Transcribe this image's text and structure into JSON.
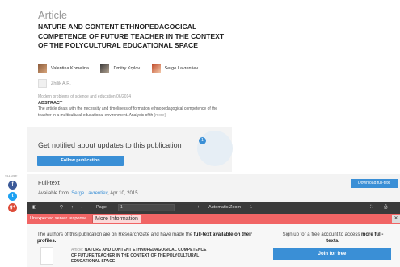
{
  "article": {
    "label": "Article",
    "title": "NATURE AND CONTENT ETHNOPEDAGOGICAL COMPETENCE OF FUTURE TEACHER IN THE CONTEXT OF THE POLYCULTURAL EDUCATIONAL SPACE",
    "authors": [
      "Valentina Komelina",
      "Dmitry Krylov",
      "Serge Lavrentiev",
      "Zhilik A.R."
    ],
    "journal": "Modern problems of science and education 06/2014",
    "abstract_heading": "ABSTRACT",
    "abstract_text": "The article deals with the necessity and timeliness of formation ethnopedagogical competence of the teacher in a multicultural educational environment. Analysis of th",
    "more_label": "[more]"
  },
  "notify": {
    "text": "Get notified about updates to this publication",
    "follow_label": "Follow publication",
    "badge": "1"
  },
  "share": {
    "label": "SHARE",
    "icons": [
      "facebook-icon",
      "twitter-icon",
      "google-plus-icon"
    ]
  },
  "fulltext": {
    "title": "Full-text",
    "available_prefix": "Available from: ",
    "author_link": "Serge Lavrentiev",
    "date": ", Apr 10, 2015",
    "download_label": "Download full-text"
  },
  "viewer": {
    "page_label": "Page:",
    "page_value": "1",
    "zoom_label": "Automatic Zoom",
    "total": "1"
  },
  "error": {
    "text": "Unexpected server response",
    "more_info": "More Information"
  },
  "bottom": {
    "note_prefix": "The authors of this publication are on ResearchGate and have made the ",
    "note_bold": "full-text available on their profiles.",
    "ref_label": "Article: ",
    "ref_title": "NATURE AND CONTENT ETHNOPEDAGOGICAL COMPETENCE OF FUTURE TEACHER IN THE CONTEXT OF THE POLYCULTURAL EDUCATIONAL SPACE",
    "signup_prefix": "Sign up for a free account to access ",
    "signup_bold": "more full-texts.",
    "join_label": "Join for free"
  },
  "colors": {
    "accent": "#3a8fd6",
    "error": "#f16565",
    "toolbar": "#3a3a3a"
  }
}
